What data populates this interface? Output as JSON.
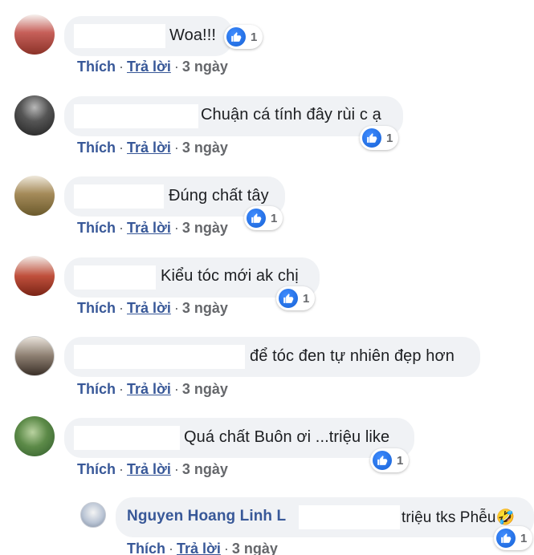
{
  "colors": {
    "bubble": "#f0f2f5",
    "link": "#385898",
    "meta": "#65676b",
    "like": "#1877f2"
  },
  "comments": [
    {
      "text": "Woa!!!",
      "reactions": "1",
      "like": "Thích",
      "reply": "Trả lời",
      "time": "3 ngày"
    },
    {
      "text": "Chuận cá tính đây rùi c ạ",
      "reactions": "1",
      "like": "Thích",
      "reply": "Trả lời",
      "time": "3 ngày"
    },
    {
      "text": "Đúng chất tây",
      "reactions": "1",
      "like": "Thích",
      "reply": "Trả lời",
      "time": "3 ngày"
    },
    {
      "text": "Kiểu tóc mới ak chị",
      "reactions": "1",
      "like": "Thích",
      "reply": "Trả lời",
      "time": "3 ngày"
    },
    {
      "text": "để tóc đen tự nhiên đẹp hơn",
      "like": "Thích",
      "reply": "Trả lời",
      "time": "3 ngày"
    },
    {
      "text": "Quá chất Buôn ơi ...triệu like",
      "reactions": "1",
      "like": "Thích",
      "reply": "Trả lời",
      "time": "3 ngày"
    }
  ],
  "reply": {
    "author": "Nguyen Hoang Linh L",
    "text": "triệu tks Phễu🤣",
    "reactions": "1",
    "like": "Thích",
    "reply": "Trả lời",
    "time": "3 ngày"
  },
  "icons": {
    "like": "thumbs-up-icon",
    "avatar": "avatar"
  }
}
